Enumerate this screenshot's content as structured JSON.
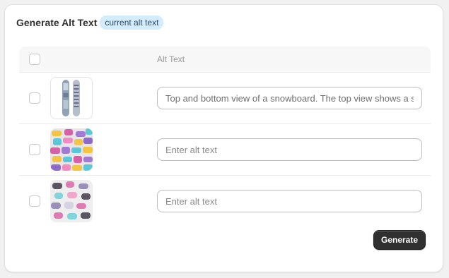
{
  "header": {
    "title": "Generate Alt Text",
    "badge": "current alt text"
  },
  "table": {
    "columns": [
      "",
      "",
      "Alt Text"
    ],
    "rows": [
      {
        "image": "snowboard-top-bottom-view",
        "alt_value": "Top and bottom view of a snowboard. The top view shows a s",
        "placeholder": "Enter alt text"
      },
      {
        "image": "colorful-dumbbells-pile",
        "alt_value": "",
        "placeholder": "Enter alt text"
      },
      {
        "image": "colorful-dumbbells-scattered",
        "alt_value": "",
        "placeholder": "Enter alt text"
      }
    ]
  },
  "actions": {
    "generate_label": "Generate"
  },
  "colors": {
    "badge_bg": "#d4ecff",
    "primary_button": "#303030"
  }
}
